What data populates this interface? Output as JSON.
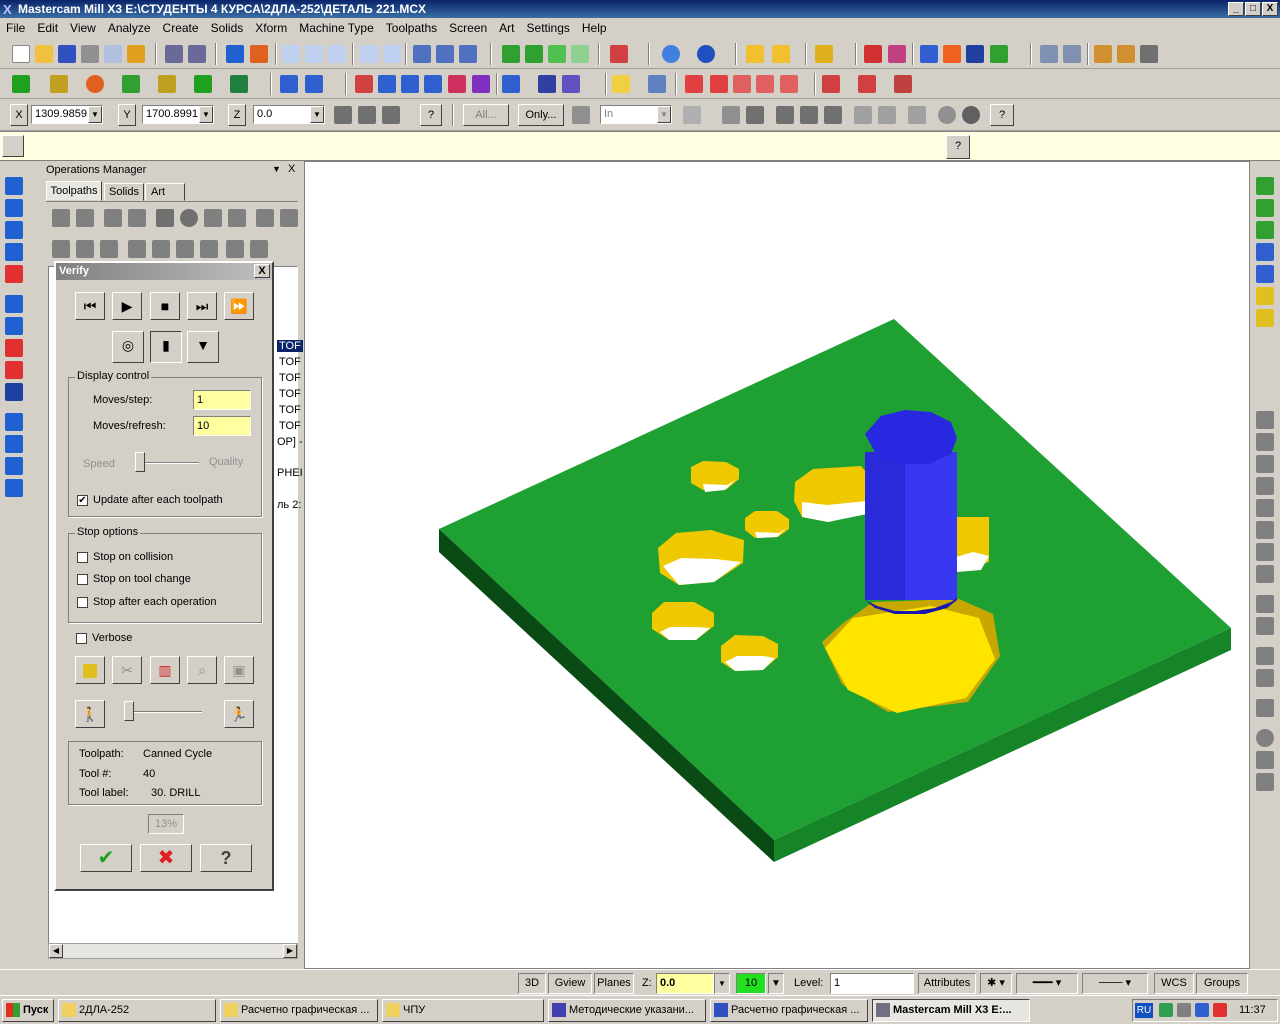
{
  "app": {
    "logo": "X",
    "title": "Mastercam Mill X3  E:\\СТУДЕНТЫ 4 КУРСА\\2ДЛА-252\\ДЕТАЛЬ 221.MCX",
    "min": "_",
    "max": "□",
    "close": "X"
  },
  "menu": [
    "File",
    "Edit",
    "View",
    "Analyze",
    "Create",
    "Solids",
    "Xform",
    "Machine Type",
    "Toolpaths",
    "Screen",
    "Art",
    "Settings",
    "Help"
  ],
  "coords": {
    "x_label": "X",
    "x_value": "1309.9859",
    "y_label": "Y",
    "y_value": "1700.8991",
    "z_label": "Z",
    "z_value": "0.0",
    "all_label": "All...",
    "only_label": "Only...",
    "in_value": "In"
  },
  "help_glyph": "?",
  "ops": {
    "title": "Operations Manager",
    "pin": "▼",
    "close": "X",
    "tabs": [
      "Toolpaths",
      "Solids",
      "Art"
    ],
    "tree_fragments": [
      "TOF",
      "TOF",
      "TOF",
      "TOF",
      "TOF",
      "TOF",
      "OP] -",
      "PHEI",
      "ль 2:"
    ]
  },
  "verify": {
    "title": "Verify",
    "close": "X",
    "display_control": "Display control",
    "moves_step_label": "Moves/step:",
    "moves_step": "1",
    "moves_refresh_label": "Moves/refresh:",
    "moves_refresh": "10",
    "speed": "Speed",
    "quality": "Quality",
    "update_label": "Update after each toolpath",
    "update_checked": true,
    "stop_options": "Stop options",
    "stop_collision": "Stop on collision",
    "stop_tool_change": "Stop on tool change",
    "stop_each_op": "Stop after each operation",
    "verbose": "Verbose",
    "toolpath_label": "Toolpath:",
    "toolpath_value": "Canned Cycle",
    "tool_no_label": "Tool #:",
    "tool_no_value": "40",
    "tool_label_label": "Tool label:",
    "tool_label_value": "30. DRILL",
    "progress": "13%",
    "ok": "✔",
    "cancel": "✖",
    "help": "?"
  },
  "status": {
    "3d": "3D",
    "gview": "Gview",
    "planes": "Planes",
    "z_label": "Z:",
    "z_value": "0.0",
    "color_value": "10",
    "level_label": "Level:",
    "level_value": "1",
    "attributes": "Attributes",
    "wcs": "WCS",
    "groups": "Groups"
  },
  "taskbar": {
    "start": "Пуск",
    "items": [
      "2ДЛА-252",
      "Расчетно графическая ...",
      "ЧПУ",
      "Методические указани...",
      "Расчетно графическая ...",
      "Mastercam Mill X3  E:..."
    ],
    "lang": "RU",
    "clock": "11:37"
  },
  "colors": {
    "part_green": "#1ea033",
    "part_green_side": "#0a4a14",
    "cutter_blue": "#2020e0",
    "hole_yellow": "#f0c800"
  }
}
